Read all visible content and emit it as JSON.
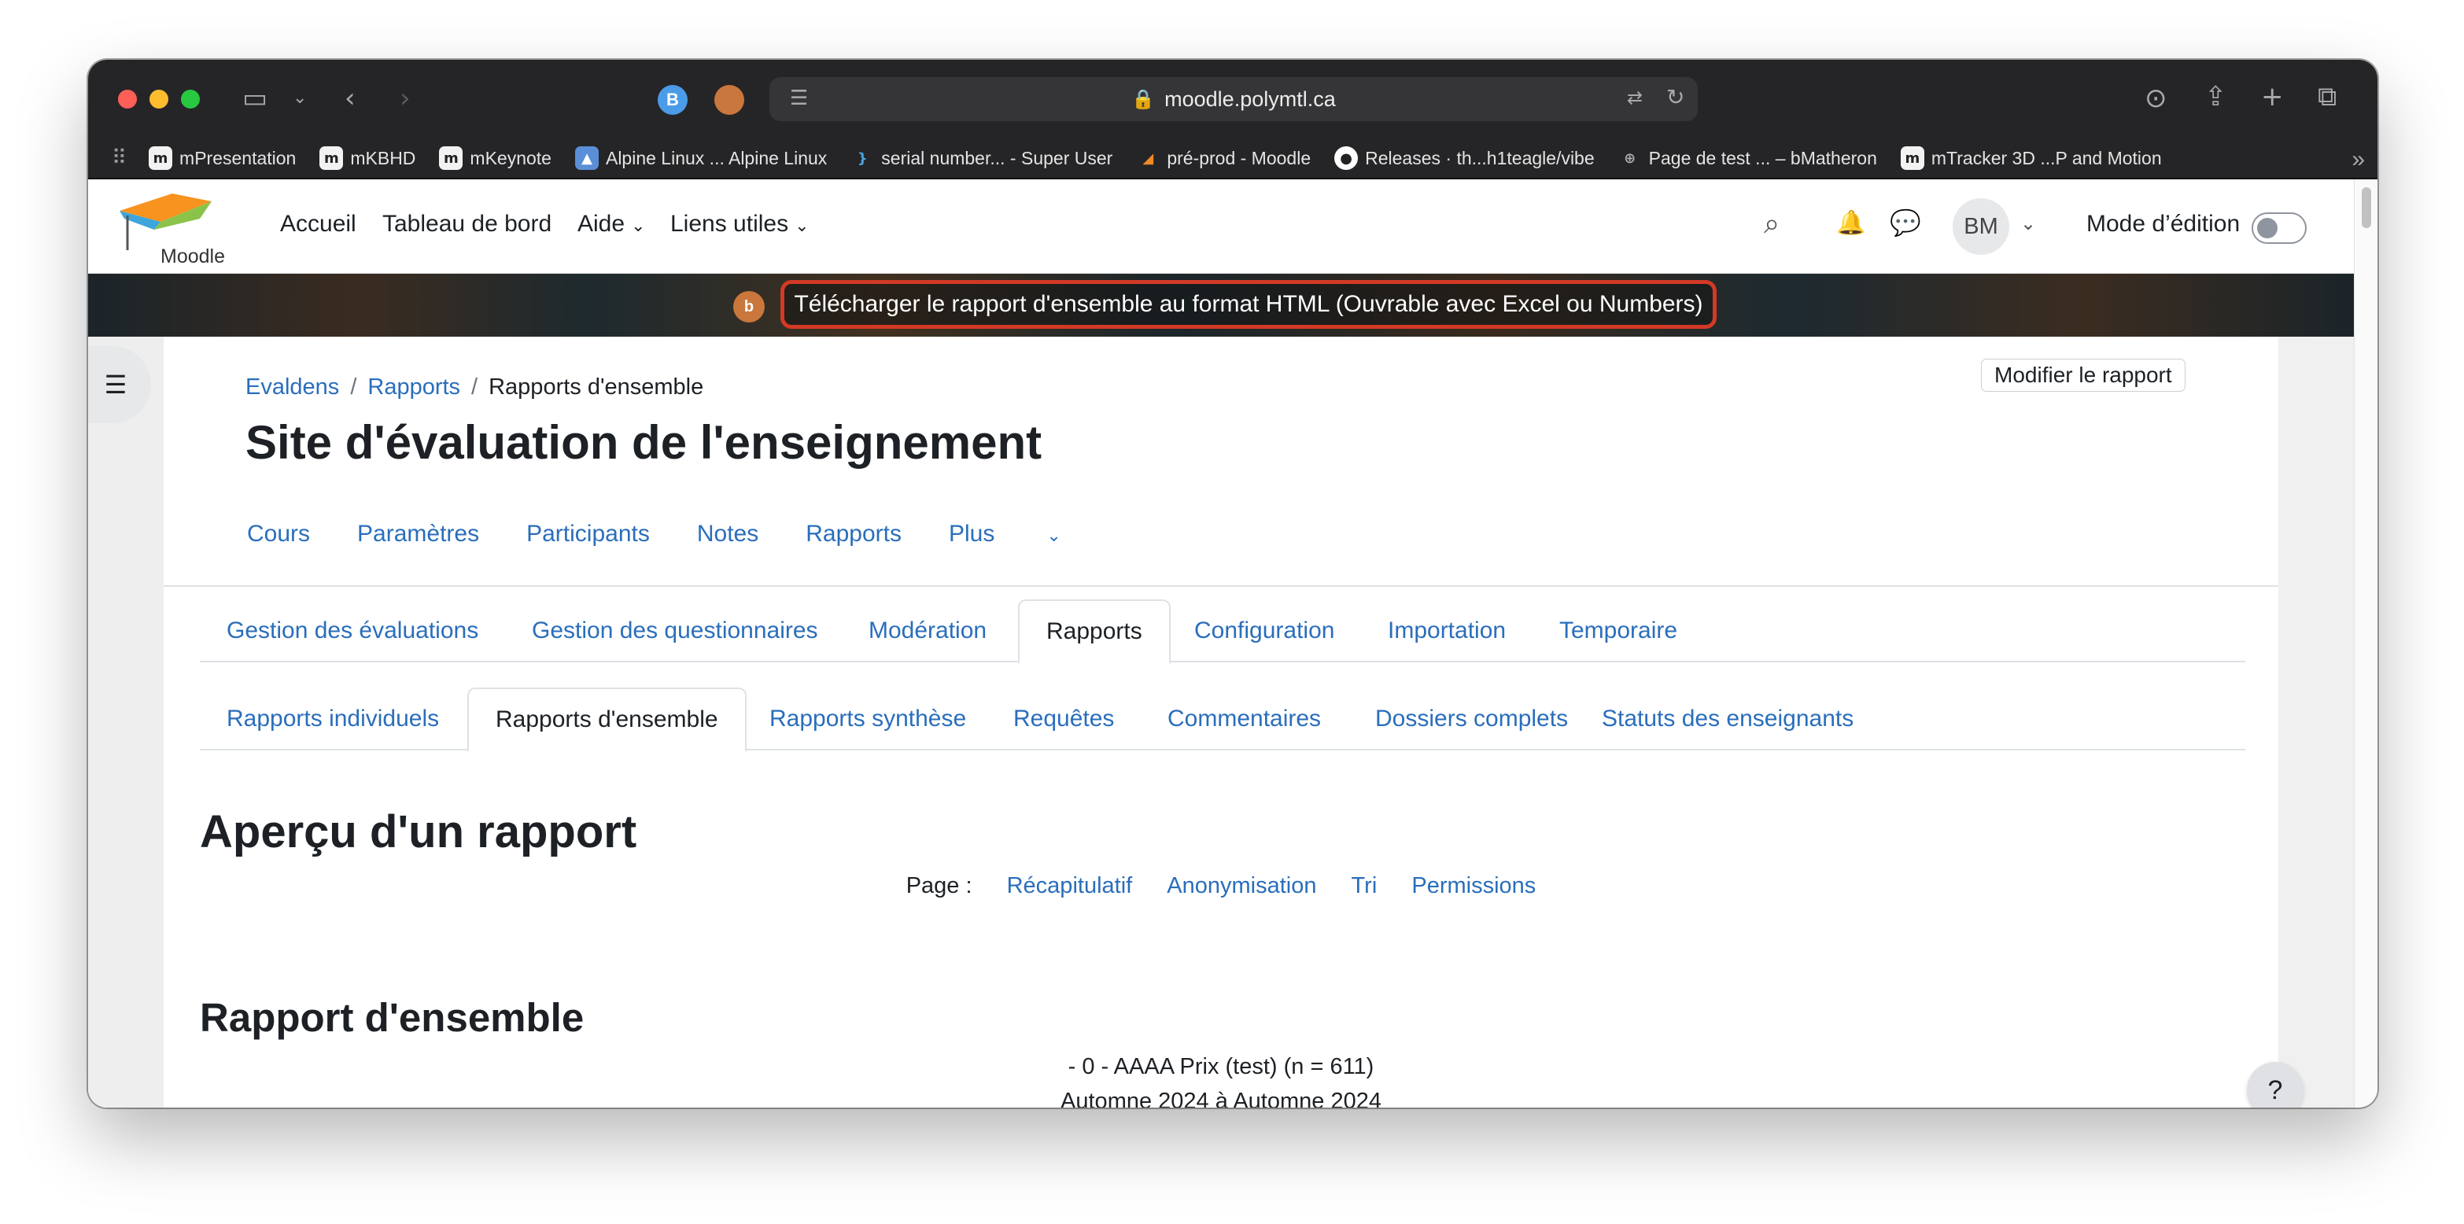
{
  "browser": {
    "url": "moodle.polymtl.ca",
    "profile_initial": "B",
    "bookmarks": [
      {
        "label": "mPresentation",
        "icon": "moodle-m-icon"
      },
      {
        "label": "mKBHD",
        "icon": "moodle-m-icon"
      },
      {
        "label": "mKeynote",
        "icon": "moodle-m-icon"
      },
      {
        "label": "Alpine Linux ... Alpine Linux",
        "icon": "alpine-icon"
      },
      {
        "label": "serial number... - Super User",
        "icon": "superuser-icon"
      },
      {
        "label": "pré-prod - Moodle",
        "icon": "moodle-hat-icon"
      },
      {
        "label": "Releases · th...h1teagle/vibe",
        "icon": "github-icon"
      },
      {
        "label": "Page de test ... – bMatheron",
        "icon": "globe-icon"
      },
      {
        "label": "mTracker 3D ...P and Motion",
        "icon": "moodle-m-icon"
      }
    ]
  },
  "moodle": {
    "logo_text": "Moodle",
    "nav": {
      "home": "Accueil",
      "dashboard": "Tableau de bord",
      "help": "Aide",
      "links": "Liens utiles"
    },
    "user_initials": "BM",
    "edit_mode_label": "Mode d’édition",
    "banner_text": "Télécharger le rapport d'ensemble au format HTML (Ouvrable avec Excel ou Numbers)",
    "breadcrumb": [
      "Evaldens",
      "Rapports",
      "Rapports d'ensemble"
    ],
    "edit_report_button": "Modifier le rapport",
    "page_title": "Site d'évaluation de l'enseignement",
    "course_nav": [
      "Cours",
      "Paramètres",
      "Participants",
      "Notes",
      "Rapports",
      "Plus"
    ],
    "tabs_primary": [
      "Gestion des évaluations",
      "Gestion des questionnaires",
      "Modération",
      "Rapports",
      "Configuration",
      "Importation",
      "Temporaire"
    ],
    "tabs_primary_active": "Rapports",
    "tabs_secondary": [
      "Rapports individuels",
      "Rapports d'ensemble",
      "Rapports synthèse",
      "Requêtes",
      "Commentaires",
      "Dossiers complets",
      "Statuts des enseignants"
    ],
    "tabs_secondary_active": "Rapports d'ensemble",
    "apercu_heading": "Aperçu d'un rapport",
    "pager_label": "Page :",
    "pager_links": [
      "Récapitulatif",
      "Anonymisation",
      "Tri",
      "Permissions"
    ],
    "report_heading": "Rapport d'ensemble",
    "report_line1": "- 0 - AAAA Prix (test) (n = 611)",
    "report_line2": "Automne 2024 à Automne 2024",
    "help_label": "?"
  }
}
